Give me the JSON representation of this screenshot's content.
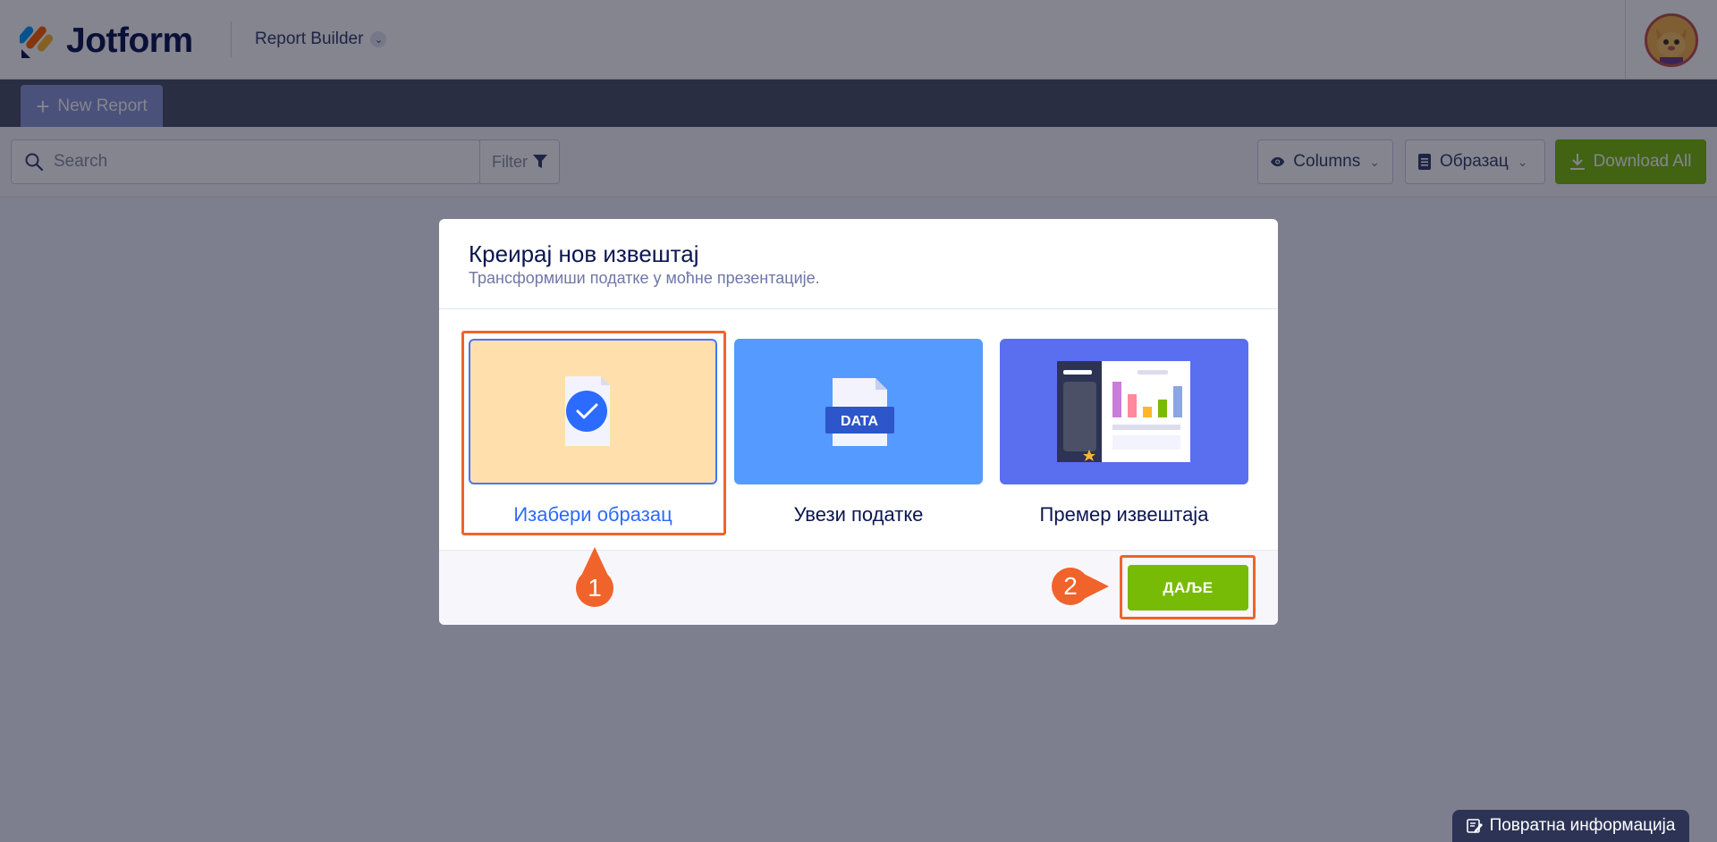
{
  "header": {
    "logo_text": "Jotform",
    "app_name": "Report Builder",
    "logo_colors": [
      "#0099ff",
      "#ff6100",
      "#ffb629",
      "#0a1551"
    ]
  },
  "tabs": [
    {
      "label": "New Report",
      "icon": "plus-icon"
    }
  ],
  "toolbar": {
    "search_placeholder": "Search",
    "filter_label": "Filter",
    "columns_label": "Columns",
    "template_label": "Образац",
    "download_label": "Download All"
  },
  "modal": {
    "title": "Креирај нов извештај",
    "subtitle": "Трансформиши податке у моћне презентације.",
    "options": [
      {
        "label": "Изабери образац",
        "selected": true,
        "icon": "form-check-icon"
      },
      {
        "label": "Увези податке",
        "selected": false,
        "icon": "data-file-icon",
        "icon_text": "DATA"
      },
      {
        "label": "Премер извештаја",
        "selected": false,
        "icon": "report-sample-icon"
      }
    ],
    "next_label": "ДАЉЕ"
  },
  "annotations": {
    "marker_1": "1",
    "marker_2": "2",
    "color": "#f0632b"
  },
  "feedback": {
    "label": "Повратна информација"
  },
  "colors": {
    "accent_green": "#78bb07",
    "tab_bg": "#4b5067",
    "selected_card": "#ffdfac",
    "data_card": "#559afe",
    "sample_card": "#5a6ef0"
  }
}
